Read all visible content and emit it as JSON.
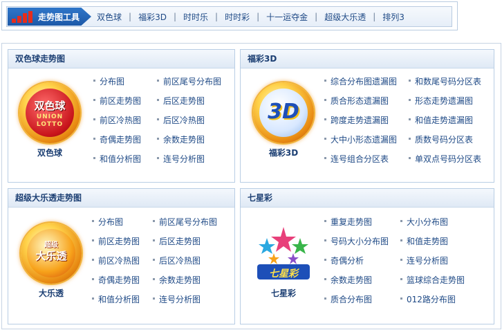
{
  "toolbar": {
    "title": "走势图工具",
    "nav": [
      "双色球",
      "福彩3D",
      "时时乐",
      "时时彩",
      "十一运夺金",
      "超级大乐透",
      "排列3"
    ],
    "separator": "|"
  },
  "panels": [
    {
      "title": "双色球走势图",
      "logo_caption": "双色球",
      "logo_text": [
        "双色球",
        "UNION",
        "LOTTO"
      ],
      "links": [
        "分布图",
        "前区尾号分布图",
        "前区走势图",
        "后区走势图",
        "前区冷热图",
        "后区冷热图",
        "奇偶走势图",
        "余数走势图",
        "和值分析图",
        "连号分析图"
      ]
    },
    {
      "title": "福彩3D",
      "logo_caption": "福彩3D",
      "logo_text": [
        "3D"
      ],
      "links": [
        "综合分布图遗漏图",
        "和数尾号码分区表",
        "质合形态遗漏图",
        "形态走势遗漏图",
        "跨度走势遗漏图",
        "和值走势遗漏图",
        "大中小形态遗漏图",
        "质数号码分区表",
        "连号组合分区表",
        "单双点号码分区表"
      ]
    },
    {
      "title": "超级大乐透走势图",
      "logo_caption": "大乐透",
      "logo_text": [
        "超级",
        "大乐透"
      ],
      "links": [
        "分布图",
        "前区尾号分布图",
        "前区走势图",
        "后区走势图",
        "前区冷热图",
        "后区冷热图",
        "奇偶走势图",
        "余数走势图",
        "和值分析图",
        "连号分析图"
      ]
    },
    {
      "title": "七星彩",
      "logo_caption": "七星彩",
      "logo_text": [
        "七星彩"
      ],
      "links": [
        "重复走势图",
        "大小分布图",
        "号码大小分布图",
        "和值走势图",
        "奇偶分析",
        "连号分析图",
        "余数走势图",
        "篮球综合走势图",
        "质合分布图",
        "012路分布图"
      ]
    }
  ],
  "colors": {
    "link": "#1f4a86",
    "header_text": "#1c3f73",
    "border": "#b8cde4",
    "tab_blue": "#1d59a8"
  }
}
